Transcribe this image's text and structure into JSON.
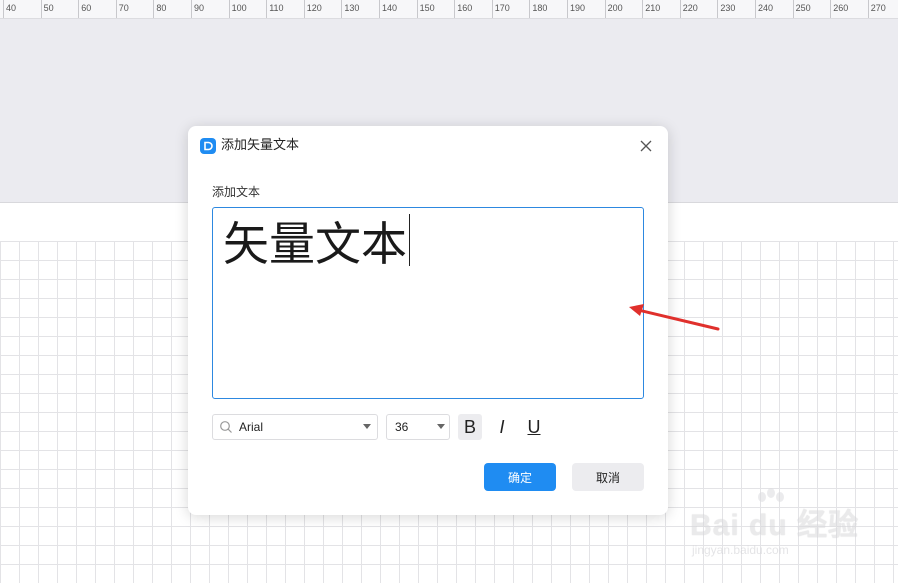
{
  "ruler": {
    "labels": [
      "40",
      "50",
      "60",
      "70",
      "80",
      "90",
      "100",
      "110",
      "120",
      "130",
      "140",
      "150",
      "160",
      "170",
      "180",
      "190",
      "200",
      "210",
      "220",
      "230",
      "240",
      "250",
      "260",
      "270"
    ]
  },
  "dialog": {
    "title": "添加矢量文本",
    "logo_glyph": "D",
    "close_icon": "close-icon",
    "section_label": "添加文本",
    "text_value": "矢量文本",
    "font_select": {
      "value": "Arial"
    },
    "size_select": {
      "value": "36"
    },
    "format_buttons": {
      "bold": "B",
      "italic": "I",
      "underline": "U"
    },
    "ok_label": "确定",
    "cancel_label": "取消"
  },
  "watermark": {
    "brand": "Bai du 经验",
    "url": "jingyan.baidu.com"
  },
  "colors": {
    "accent": "#1f8cf2",
    "annotation_arrow": "#e0302c",
    "canvas_gray": "#ebebf0"
  }
}
